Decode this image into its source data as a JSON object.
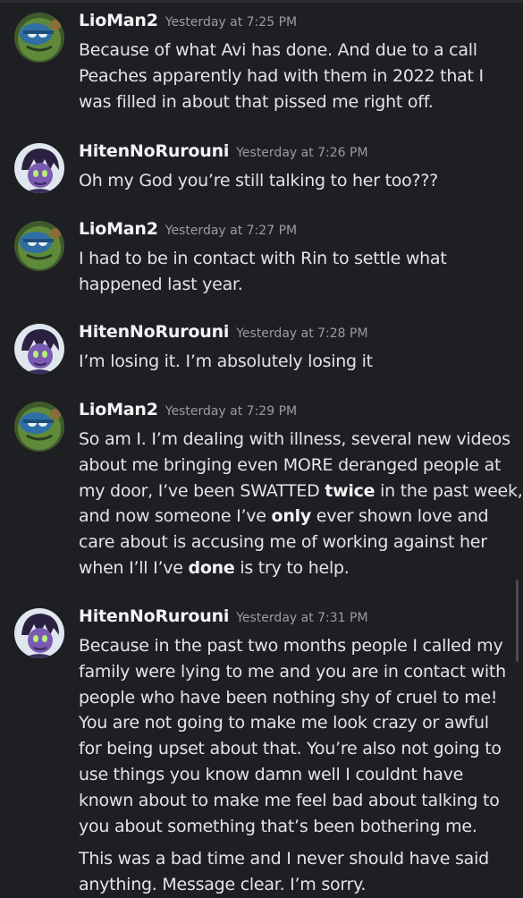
{
  "messages": [
    {
      "author": "LioMan2",
      "time": "Yesterday at 7:25 PM",
      "lines": [
        "Because of what Avi has done. And due to a call",
        "Peaches apparently had with them in 2022 that I",
        "was filled in about that pissed me right off."
      ]
    },
    {
      "author": "HitenNoRurouni",
      "time": "Yesterday at 7:26 PM",
      "lines": [
        "Oh my God you’re still talking to her too???"
      ]
    },
    {
      "author": "LioMan2",
      "time": "Yesterday at 7:27 PM",
      "lines": [
        "I had to be in contact with Rin to settle what",
        "happened last year."
      ]
    },
    {
      "author": "HitenNoRurouni",
      "time": "Yesterday at 7:28 PM",
      "lines": [
        "I’m losing it. I’m absolutely losing it"
      ]
    },
    {
      "author": "LioMan2",
      "time": "Yesterday at 7:29 PM",
      "lines": [
        "So am I. I’m dealing with illness, several new videos",
        "about me bringing even MORE deranged people at"
      ],
      "l3a": "my door, I’ve been SWATTED ",
      "l3b": "twice",
      "l3c": " in the past week,",
      "l4a": "and now someone I’ve ",
      "l4b": "only",
      "l4c": " ever shown love and",
      "l5": "care about is accusing me of working against her",
      "l6a": "when I’ll I’ve ",
      "l6b": "done",
      "l6c": " is try to help."
    },
    {
      "author": "HitenNoRurouni",
      "time": "Yesterday at 7:31 PM",
      "lines": [
        "Because in the past two months people I called my",
        "family were lying to me and you are in contact with",
        "people who have been nothing shy of cruel to me!",
        "You are not going to make me look crazy or awful",
        "for being upset about that. You’re also not going to",
        "use things you know damn well I couldnt have",
        "known about to make me feel bad about talking to",
        "you about something that’s been bothering me."
      ],
      "followup": [
        "This was a bad time and I never should have said",
        "anything. Message clear. I’m sorry."
      ]
    }
  ],
  "colors": {
    "background": "#1e1f22",
    "username": "#f2f3f5",
    "timestamp": "#9a9ca3",
    "text": "#e3e4e8"
  },
  "icons": {
    "liomaan2_avatar": "turtle-avatar-icon",
    "hiten_avatar": "purple-character-avatar-icon"
  }
}
